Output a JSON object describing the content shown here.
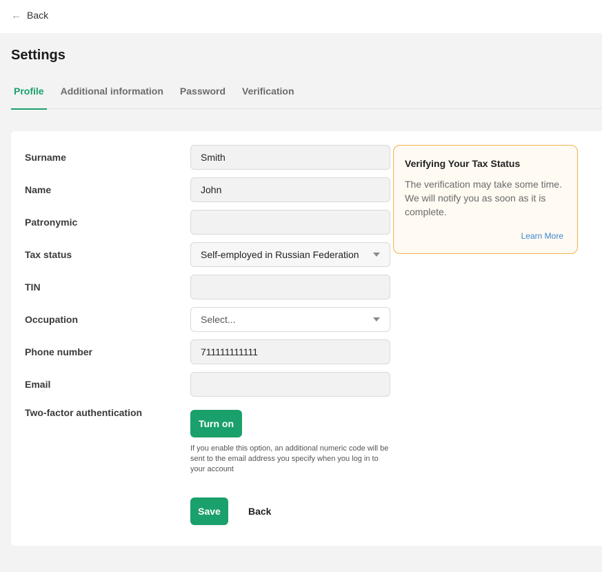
{
  "nav": {
    "back_label": "Back"
  },
  "page": {
    "title": "Settings"
  },
  "tabs": [
    {
      "label": "Profile",
      "active": true
    },
    {
      "label": "Additional information",
      "active": false
    },
    {
      "label": "Password",
      "active": false
    },
    {
      "label": "Verification",
      "active": false
    }
  ],
  "form": {
    "surname": {
      "label": "Surname",
      "value": "Smith"
    },
    "name": {
      "label": "Name",
      "value": "John"
    },
    "patronymic": {
      "label": "Patronymic",
      "value": ""
    },
    "tax_status": {
      "label": "Tax status",
      "value": "Self-employed in Russian Federation"
    },
    "tin": {
      "label": "TIN",
      "value": ""
    },
    "occupation": {
      "label": "Occupation",
      "placeholder": "Select..."
    },
    "phone": {
      "label": "Phone number",
      "value": "711111111111"
    },
    "email": {
      "label": "Email",
      "value": ""
    },
    "twofa": {
      "label": "Two-factor authentication",
      "button_label": "Turn on",
      "hint": "If you enable this option, an additional numeric code will be sent to the email address you specify when you log in to your account"
    }
  },
  "actions": {
    "save_label": "Save",
    "back_label": "Back"
  },
  "notice": {
    "title": "Verifying Your Tax Status",
    "text": "The verification may take some time. We will notify you as soon as it is complete.",
    "link_label": "Learn More"
  },
  "colors": {
    "accent": "#1aa06a",
    "notice_border": "#f0b14a",
    "link": "#3a86d4"
  }
}
